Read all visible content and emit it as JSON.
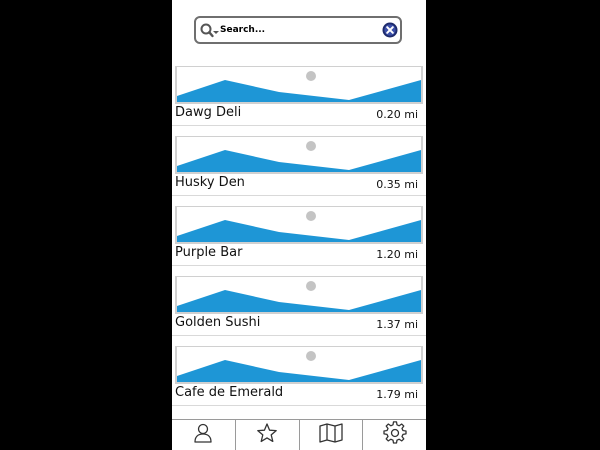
{
  "search": {
    "placeholder": "Search..."
  },
  "places": [
    {
      "name": "Dawg Deli",
      "distance": "0.20 mi"
    },
    {
      "name": "Husky Den",
      "distance": "0.35 mi"
    },
    {
      "name": "Purple Bar",
      "distance": "1.20 mi"
    },
    {
      "name": "Golden Sushi",
      "distance": "1.37 mi"
    },
    {
      "name": "Cafe de Emerald",
      "distance": "1.79 mi"
    }
  ],
  "tabs": [
    {
      "icon": "person-icon"
    },
    {
      "icon": "star-icon"
    },
    {
      "icon": "map-icon"
    },
    {
      "icon": "gear-icon"
    }
  ],
  "colors": {
    "thumbnail_mountain": "#1e96d6",
    "thumbnail_background": "#d0d0d0",
    "thumbnail_sky": "#ffffff",
    "thumbnail_sun": "#c4c4c4",
    "clear_button": "#1d2a6b"
  }
}
